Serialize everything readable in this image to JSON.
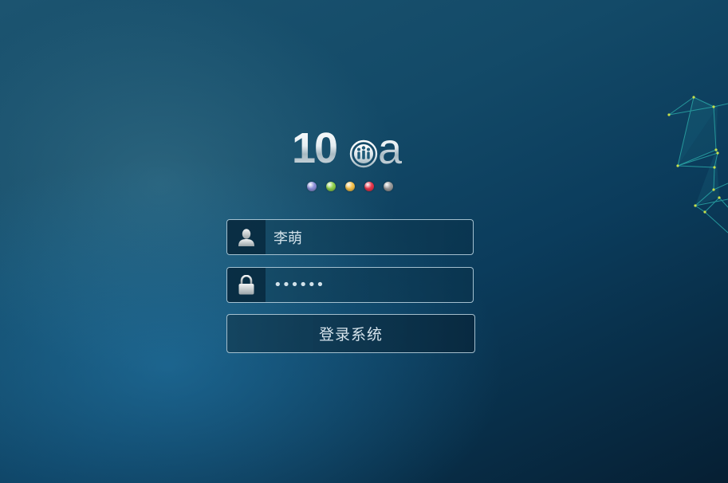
{
  "logo": {
    "digits": "10",
    "letter": "a"
  },
  "dots": [
    {
      "name": "dot-purple",
      "color": "#8c8fd8"
    },
    {
      "name": "dot-green",
      "color": "#8fd04a"
    },
    {
      "name": "dot-yellow",
      "color": "#f3c04a"
    },
    {
      "name": "dot-red",
      "color": "#e8354a"
    },
    {
      "name": "dot-gray",
      "color": "#9a9a9a"
    }
  ],
  "login": {
    "username_value": "李萌",
    "password_value": "••••••",
    "submit_label": "登录系统",
    "user_icon": "user-icon",
    "lock_icon": "lock-icon"
  },
  "colors": {
    "field_border": "#bed7e4",
    "accent_dot": "#c8e04a",
    "network_line": "#2aa6a6"
  }
}
